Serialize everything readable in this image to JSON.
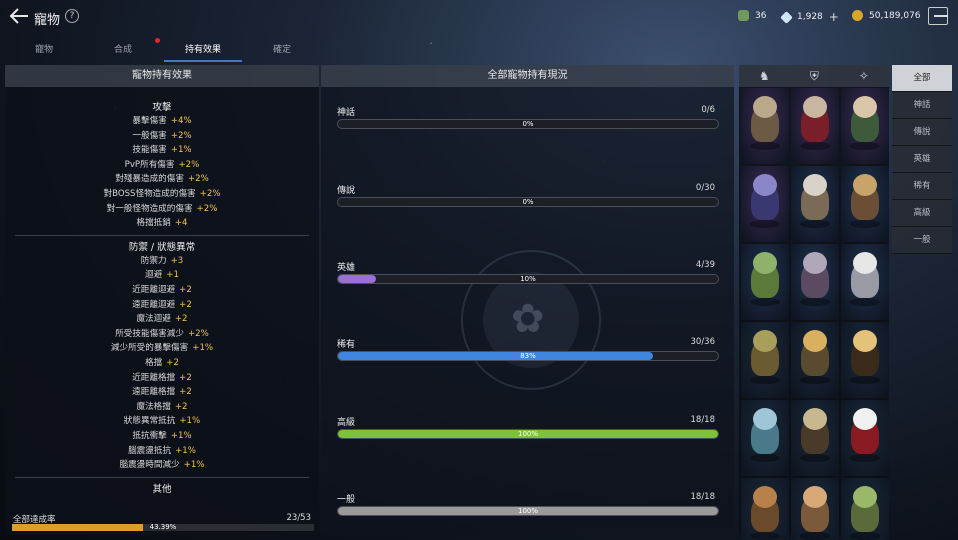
{
  "header": {
    "title": "寵物",
    "help": "?"
  },
  "resources": [
    {
      "icon": "gem-bag-icon",
      "value": "36",
      "color": "#6f9a5a"
    },
    {
      "icon": "diamond-icon",
      "value": "1,928",
      "color": "#cfe6ff"
    },
    {
      "icon": "gold-coin-icon",
      "value": "50,189,076",
      "color": "#d9a62a"
    }
  ],
  "tabs": [
    {
      "label": "寵物",
      "active": false
    },
    {
      "label": "合成",
      "active": false
    },
    {
      "label": "持有效果",
      "active": true
    },
    {
      "label": "確定",
      "active": false
    }
  ],
  "left_panel": {
    "title": "寵物持有效果",
    "groups": [
      {
        "title": "攻擊",
        "stats": [
          {
            "name": "暴擊傷害",
            "value": "+4%"
          },
          {
            "name": "一般傷害",
            "value": "+2%"
          },
          {
            "name": "技能傷害",
            "value": "+1%"
          },
          {
            "name": "PvP所有傷害",
            "value": "+2%"
          },
          {
            "name": "對殘暴造成的傷害",
            "value": "+2%"
          },
          {
            "name": "對BOSS怪物造成的傷害",
            "value": "+2%"
          },
          {
            "name": "對一般怪物造成的傷害",
            "value": "+2%"
          },
          {
            "name": "格擋抵銷",
            "value": "+4"
          }
        ]
      },
      {
        "title": "防禦 / 狀態異常",
        "stats": [
          {
            "name": "防禦力",
            "value": "+3"
          },
          {
            "name": "迴避",
            "value": "+1"
          },
          {
            "name": "近距離迴避",
            "value": "+2"
          },
          {
            "name": "遠距離迴避",
            "value": "+2"
          },
          {
            "name": "魔法迴避",
            "value": "+2"
          },
          {
            "name": "所受技能傷害減少",
            "value": "+2%"
          },
          {
            "name": "減少所受的暴擊傷害",
            "value": "+1%"
          },
          {
            "name": "格擋",
            "value": "+2"
          },
          {
            "name": "近距離格擋",
            "value": "+2"
          },
          {
            "name": "遠距離格擋",
            "value": "+2"
          },
          {
            "name": "魔法格擋",
            "value": "+2"
          },
          {
            "name": "狀態異常抵抗",
            "value": "+1%"
          },
          {
            "name": "抵抗衝擊",
            "value": "+1%"
          },
          {
            "name": "腦震盪抵抗",
            "value": "+1%"
          },
          {
            "name": "腦震盪時間減少",
            "value": "+1%"
          }
        ]
      },
      {
        "title": "其他",
        "stats": []
      }
    ],
    "total": {
      "label": "全部達成率",
      "count": "23/53",
      "percent_text": "43.39%",
      "percent": 43.39
    }
  },
  "mid_panel": {
    "title": "全部寵物持有現況",
    "rarities": [
      {
        "name": "神話",
        "count": "0/6",
        "percent_text": "0%",
        "percent": 0,
        "color": "#888888"
      },
      {
        "name": "傳說",
        "count": "0/30",
        "percent_text": "0%",
        "percent": 0,
        "color": "#888888"
      },
      {
        "name": "英雄",
        "count": "4/39",
        "percent_text": "10%",
        "percent": 10,
        "color": "#9b6fd6"
      },
      {
        "name": "稀有",
        "count": "30/36",
        "percent_text": "83%",
        "percent": 83,
        "color": "#3f86e0"
      },
      {
        "name": "高級",
        "count": "18/18",
        "percent_text": "100%",
        "percent": 100,
        "color": "#7cc23e"
      },
      {
        "name": "一般",
        "count": "18/18",
        "percent_text": "100%",
        "percent": 100,
        "color": "#9a9a9a"
      }
    ]
  },
  "grid_header": {
    "icons": [
      "pet-type-icon",
      "shield-type-icon",
      "star-type-icon"
    ]
  },
  "pets": [
    {
      "icon": "goat-warrior-pet-icon",
      "bg": "#3b2a55",
      "head": "#b9a98a",
      "body": "#6d5a44"
    },
    {
      "icon": "red-demon-pet-icon",
      "bg": "#3b2a55",
      "head": "#c8b6a0",
      "body": "#7a1f2a"
    },
    {
      "icon": "dark-elf-pet-icon",
      "bg": "#3b2a55",
      "head": "#d9c6a8",
      "body": "#3d5a3a"
    },
    {
      "icon": "void-beast-pet-icon",
      "bg": "#3b2a55",
      "head": "#8a86c8",
      "body": "#3a3870"
    },
    {
      "icon": "stone-golem-pet-icon",
      "bg": "#1f3350",
      "head": "#d8d2c8",
      "body": "#7b6a55"
    },
    {
      "icon": "knight-pet-icon",
      "bg": "#1f3350",
      "head": "#c9a46a",
      "body": "#6b4f34"
    },
    {
      "icon": "lizard-pet-icon",
      "bg": "#1f3350",
      "head": "#8fb26a",
      "body": "#5b7a3a"
    },
    {
      "icon": "horned-helm-pet-icon",
      "bg": "#1f3350",
      "head": "#b0a8b8",
      "body": "#5a4a62"
    },
    {
      "icon": "white-elf-pet-icon",
      "bg": "#1f3350",
      "head": "#e6e6e6",
      "body": "#9a9aa4"
    },
    {
      "icon": "orc-pet-icon",
      "bg": "#1a2a3a",
      "head": "#a8a05a",
      "body": "#6a5a30"
    },
    {
      "icon": "golden-knight-pet-icon",
      "bg": "#1a2a3a",
      "head": "#d8b060",
      "body": "#5a4a30"
    },
    {
      "icon": "pyramid-pet-icon",
      "bg": "#1a2a3a",
      "head": "#e4c27a",
      "body": "#3a2a1a"
    },
    {
      "icon": "ice-wolf-pet-icon",
      "bg": "#1a2a3a",
      "head": "#9ec6d6",
      "body": "#4a7a8a"
    },
    {
      "icon": "bone-warrior-pet-icon",
      "bg": "#1a2a3a",
      "head": "#c8b890",
      "body": "#4a3a2a"
    },
    {
      "icon": "panda-mage-pet-icon",
      "bg": "#1a2a3a",
      "head": "#f0f0f0",
      "body": "#8a1a22"
    },
    {
      "icon": "monkey-pet-icon",
      "bg": "#1a2a3a",
      "head": "#b8804a",
      "body": "#6a4a2a"
    },
    {
      "icon": "dwarf-pet-icon",
      "bg": "#1a2a3a",
      "head": "#d9a878",
      "body": "#7a5a3a"
    },
    {
      "icon": "goblin-pet-icon",
      "bg": "#1a2a3a",
      "head": "#9ab86a",
      "body": "#5a6a3a"
    }
  ],
  "filters": [
    {
      "label": "全部",
      "active": true
    },
    {
      "label": "神話",
      "active": false
    },
    {
      "label": "傳說",
      "active": false
    },
    {
      "label": "英雄",
      "active": false
    },
    {
      "label": "稀有",
      "active": false
    },
    {
      "label": "高級",
      "active": false
    },
    {
      "label": "一般",
      "active": false
    }
  ]
}
